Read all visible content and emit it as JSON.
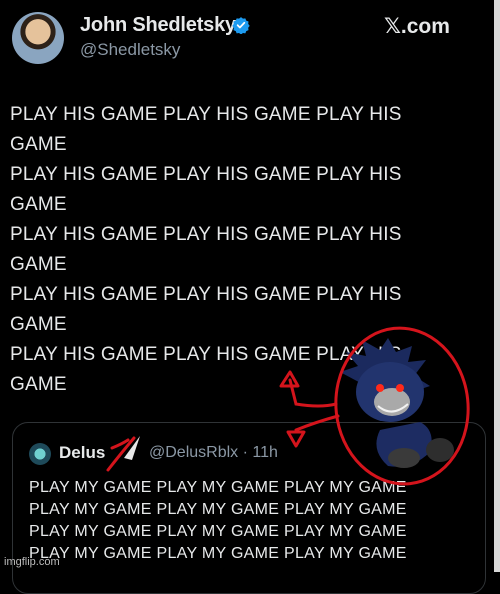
{
  "header": {
    "display_name": "John Shedletsky",
    "handle": "@Shedletsky",
    "site": "𝕏.com",
    "avatar_icon": "user-avatar",
    "verified_icon": "verified-badge-icon",
    "verified_color": "#1d9bf0"
  },
  "tweet": {
    "lines": [
      "PLAY HIS GAME PLAY HIS GAME PLAY HIS",
      "GAME",
      "PLAY HIS GAME PLAY HIS GAME PLAY HIS",
      "GAME",
      "PLAY HIS GAME PLAY HIS GAME PLAY HIS",
      "GAME",
      "PLAY HIS GAME PLAY HIS GAME PLAY HIS",
      "GAME",
      "PLAY HIS GAME PLAY HIS GAME PLAY HIS",
      "GAME"
    ]
  },
  "quote": {
    "name": "Delus",
    "handle_time": "@DelusRblx · 11h",
    "lines": [
      "PLAY MY GAME PLAY MY GAME PLAY MY GAME",
      "PLAY MY GAME PLAY MY GAME PLAY MY GAME",
      "PLAY MY GAME PLAY MY GAME PLAY MY GAME",
      "PLAY MY GAME PLAY MY GAME PLAY MY GAME"
    ]
  },
  "annotation": {
    "color": "#d4141c",
    "character_icon": "dark-hedgehog-character"
  },
  "watermark": "imgflip.com"
}
